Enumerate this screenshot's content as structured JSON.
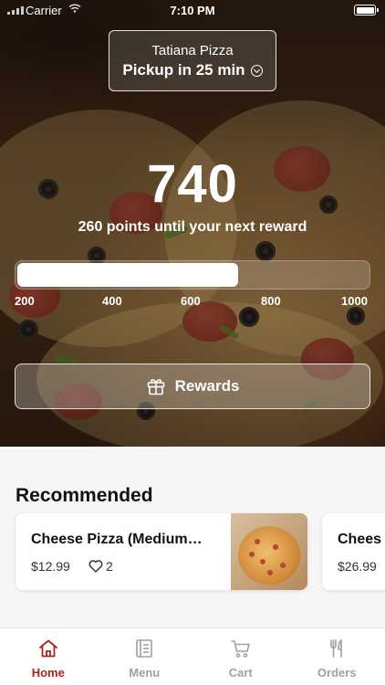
{
  "status_bar": {
    "carrier": "Carrier",
    "time": "7:10 PM"
  },
  "store": {
    "name": "Tatiana Pizza",
    "pickup": "Pickup in 25 min",
    "icon": "chevron-circle-down-icon"
  },
  "loyalty": {
    "points": "740",
    "subtitle": "260 points until your next reward",
    "progress_fraction": 0.63,
    "ticks": [
      "200",
      "400",
      "600",
      "800",
      "1000"
    ]
  },
  "rewards_button": {
    "label": "Rewards",
    "icon": "gift-icon"
  },
  "recommended": {
    "title": "Recommended",
    "items": [
      {
        "name": "Cheese Pizza (Medium…",
        "price": "$12.99",
        "likes": "2",
        "image_icon": "pizza-photo"
      },
      {
        "name": "Chees",
        "price": "$26.99"
      }
    ]
  },
  "tabs": [
    {
      "label": "Home",
      "icon": "home-icon",
      "active": true
    },
    {
      "label": "Menu",
      "icon": "menu-icon",
      "active": false
    },
    {
      "label": "Cart",
      "icon": "cart-icon",
      "active": false
    },
    {
      "label": "Orders",
      "icon": "fork-knife-icon",
      "active": false
    }
  ],
  "colors": {
    "accent": "#b0211d",
    "inactive_tab": "#a0a0a0"
  }
}
